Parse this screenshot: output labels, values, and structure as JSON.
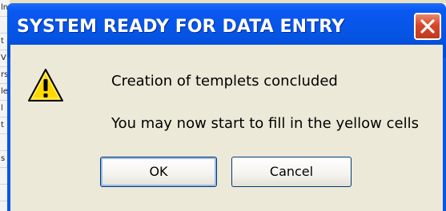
{
  "background_sheet": {
    "cells": [
      "ln",
      "",
      "t",
      "V",
      "rs",
      "le",
      "l",
      "t",
      "",
      "s",
      "",
      ""
    ]
  },
  "dialog": {
    "title": "SYSTEM READY FOR DATA ENTRY",
    "close_icon": "close-x-icon",
    "icon": "warning-icon",
    "message_line1": "Creation of templets concluded",
    "message_line2": "You may now start to fill in the yellow cells",
    "ok_label": "OK",
    "cancel_label": "Cancel"
  },
  "colors": {
    "titlebar": "#0554e3",
    "close_button": "#d8462a",
    "client": "#ece9d8",
    "warning_yellow": "#ffd800"
  }
}
